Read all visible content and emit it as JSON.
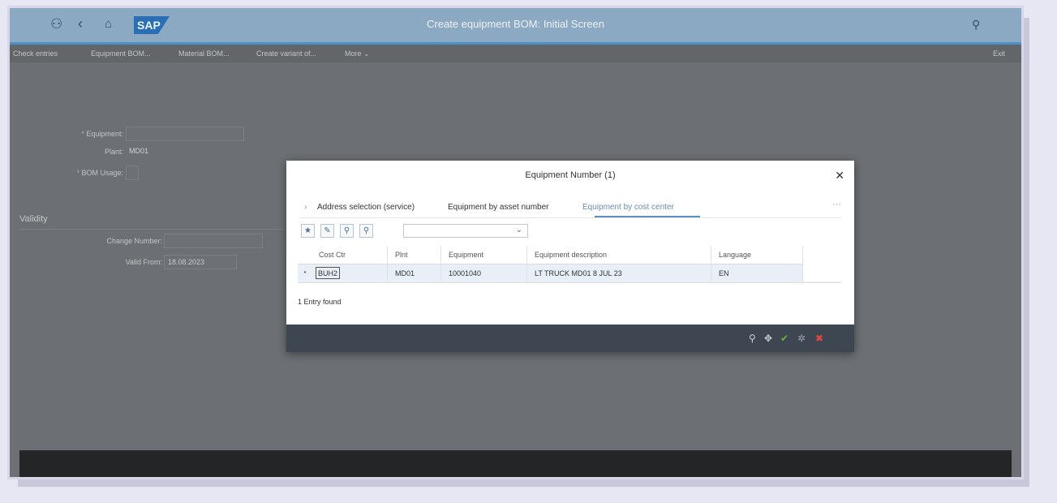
{
  "shell": {
    "title": "Create equipment BOM: Initial Screen",
    "logo": "SAP",
    "icons": [
      "user-icon",
      "back-icon",
      "home-icon",
      "search-icon"
    ]
  },
  "toolbar": {
    "items": [
      "Check entries",
      "Equipment BOM...",
      "Material BOM...",
      "Create variant of...",
      "More ⌄"
    ],
    "exit": "Exit"
  },
  "form": {
    "equipment_label": "Equipment:",
    "plant_label": "Plant:",
    "plant_value": "MD01",
    "bom_usage_label": "BOM Usage:",
    "validity_title": "Validity",
    "change_number_label": "Change Number:",
    "valid_from_label": "Valid From:",
    "valid_from_value": "18.08.2023"
  },
  "dialog": {
    "title": "Equipment Number (1)",
    "tabs": [
      "Address selection (service)",
      "Equipment by asset number",
      "Equipment by cost center"
    ],
    "selected_tab": 2,
    "columns": [
      "Cost Ctr",
      "Plnt",
      "Equipment",
      "Equipment description",
      "Language"
    ],
    "rows": [
      [
        "BUH2",
        "MD01",
        "10001040",
        "LT TRUCK MD01 8 JUL 23",
        "EN"
      ]
    ],
    "status": "1 Entry found"
  },
  "colors": {
    "shell_bar": "#8ca9c3",
    "accent": "#4d8fc8",
    "overlay": "#6c6f73",
    "dialog_footer": "#3e4751",
    "confirm_icon": "#68b04a",
    "cancel_icon": "#e0483e"
  }
}
